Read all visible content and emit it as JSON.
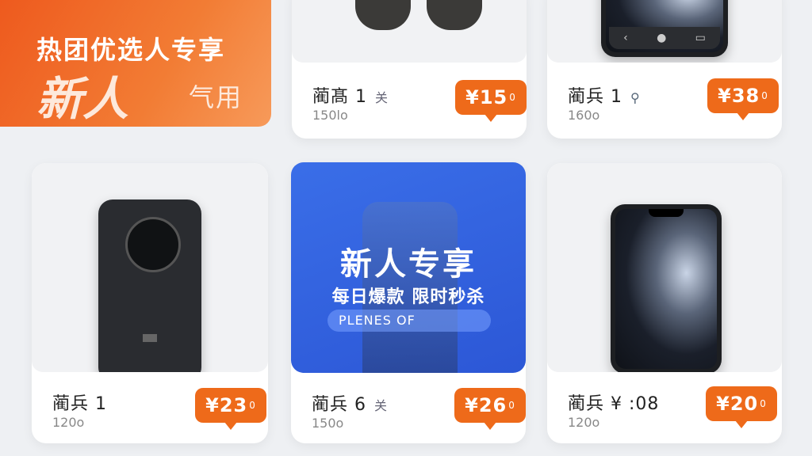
{
  "banner": {
    "line1": "热团优选人专享",
    "line2": "新人",
    "line3": "气用"
  },
  "promo": {
    "title": "新人专享",
    "subtitle": "每日爆款 限时秒杀",
    "pill": "PLENES OF"
  },
  "products": [
    {
      "name": "蔺髙 1",
      "tag": "关",
      "sub": "150lo",
      "price": "¥15",
      "unit": "0"
    },
    {
      "name": "蔺兵 1",
      "tag": "",
      "sub": "160o",
      "price": "¥38",
      "unit": "0"
    },
    {
      "name": "蔺兵 1",
      "tag": "",
      "sub": "120o",
      "price": "¥23",
      "unit": "0"
    },
    {
      "name": "蔺兵 6",
      "tag": "关",
      "sub": "150o",
      "price": "¥26",
      "unit": "0"
    },
    {
      "name": "蔺兵 ¥ :08",
      "tag": "",
      "sub": "120o",
      "price": "¥20",
      "unit": "0"
    }
  ],
  "colors": {
    "accent": "#ee6a1a",
    "promo_blue": "#2c57d6"
  },
  "icons": [
    "back-icon",
    "home-icon",
    "recent-apps-icon",
    "search-user-icon"
  ]
}
